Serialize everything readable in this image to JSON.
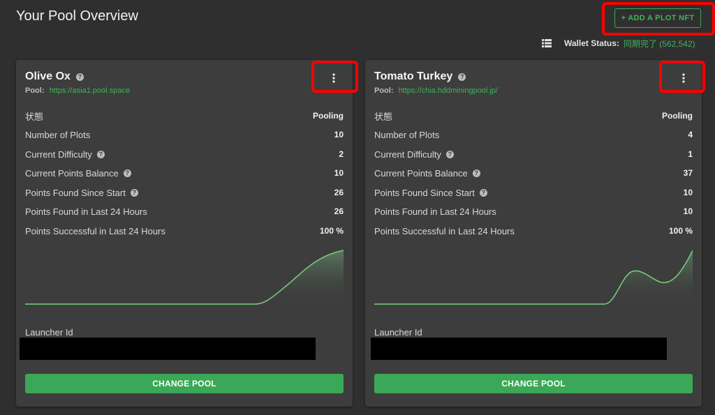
{
  "header": {
    "title": "Your Pool Overview",
    "add_plot_nft_label": "+ ADD A PLOT NFT"
  },
  "wallet": {
    "label": "Wallet Status:",
    "value": "同期完了 (562,542)",
    "icon": "list-icon"
  },
  "cards": [
    {
      "name": "Olive Ox",
      "pool_label": "Pool:",
      "pool_url": "https://asia1.pool.space",
      "stats": [
        {
          "label": "状態",
          "value": "Pooling"
        },
        {
          "label": "Number of Plots",
          "value": "10"
        },
        {
          "label": "Current Difficulty",
          "value": "2"
        },
        {
          "label": "Current Points Balance",
          "value": "10"
        },
        {
          "label": "Points Found Since Start",
          "value": "26"
        },
        {
          "label": "Points Found in Last 24 Hours",
          "value": "26"
        },
        {
          "label": "Points Successful in Last 24 Hours",
          "value": "100 %"
        }
      ],
      "launcher_label": "Launcher Id",
      "change_pool_label": "CHANGE POOL"
    },
    {
      "name": "Tomato Turkey",
      "pool_label": "Pool:",
      "pool_url": "https://chia.hddminingpool.jp/",
      "stats": [
        {
          "label": "状態",
          "value": "Pooling"
        },
        {
          "label": "Number of Plots",
          "value": "4"
        },
        {
          "label": "Current Difficulty",
          "value": "1"
        },
        {
          "label": "Current Points Balance",
          "value": "37"
        },
        {
          "label": "Points Found Since Start",
          "value": "10"
        },
        {
          "label": "Points Found in Last 24 Hours",
          "value": "10"
        },
        {
          "label": "Points Successful in Last 24 Hours",
          "value": "100 %"
        }
      ],
      "launcher_label": "Launcher Id",
      "change_pool_label": "CHANGE POOL"
    }
  ],
  "colors": {
    "accent": "#3aa856",
    "background": "#2f2f2f",
    "card": "#3d3d3d",
    "highlight": "#ff0000"
  }
}
